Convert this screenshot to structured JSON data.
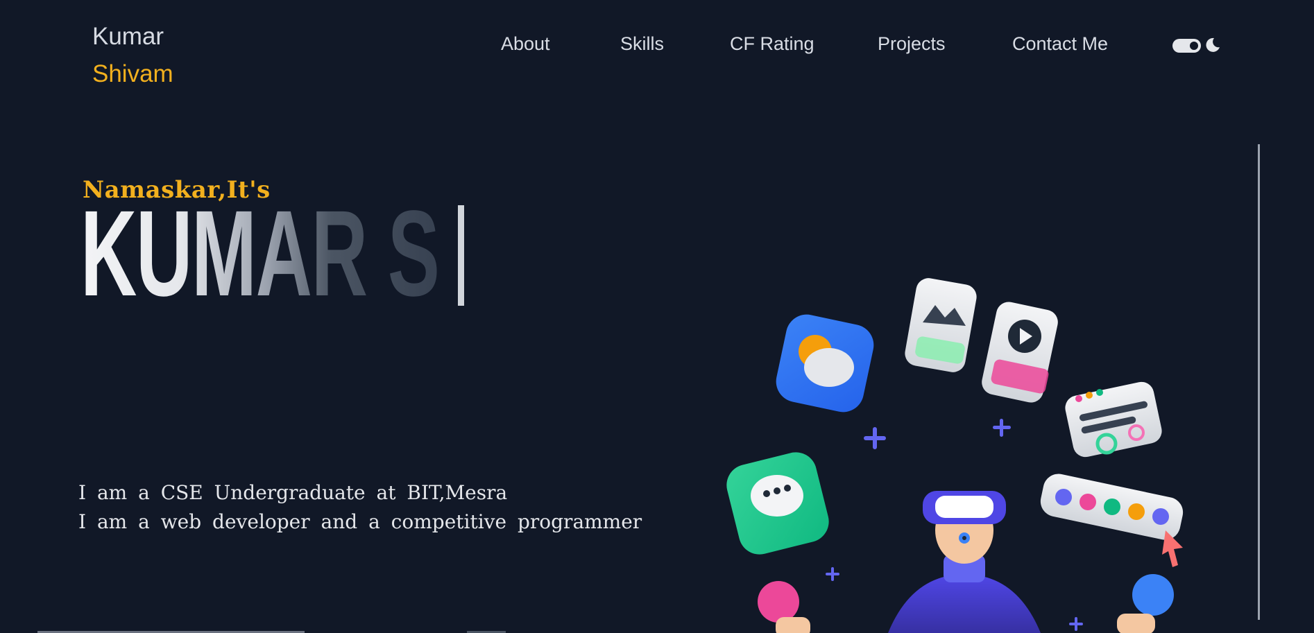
{
  "logo": {
    "first_name": "Kumar",
    "last_name": "Shivam"
  },
  "nav": {
    "items": [
      {
        "label": "About"
      },
      {
        "label": "Skills"
      },
      {
        "label": "CF Rating"
      },
      {
        "label": "Projects"
      },
      {
        "label": "Contact Me"
      }
    ]
  },
  "theme_toggle": {
    "icon": "toggle-icon",
    "mode_icon": "moon-icon"
  },
  "hero": {
    "greeting": "Namaskar,It's",
    "typed_name": "KUMAR S",
    "intro_lines": [
      "I am a CSE Undergraduate at BIT,Mesra",
      "I am a web developer and a competitive programmer"
    ]
  },
  "colors": {
    "background": "#111827",
    "accent": "#f2b01e",
    "text": "#d1d5db"
  }
}
